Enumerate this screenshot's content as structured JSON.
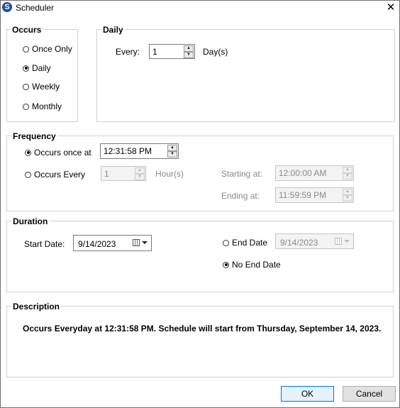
{
  "window": {
    "title": "Scheduler",
    "app_icon_letter": "S",
    "close_glyph": "✕"
  },
  "occurs": {
    "label": "Occurs",
    "options": [
      {
        "label": "Once Only",
        "selected": false
      },
      {
        "label": "Daily",
        "selected": true
      },
      {
        "label": "Weekly",
        "selected": false
      },
      {
        "label": "Monthly",
        "selected": false
      }
    ]
  },
  "daily": {
    "label": "Daily",
    "every_label": "Every:",
    "every_value": "1",
    "unit": "Day(s)"
  },
  "frequency": {
    "label": "Frequency",
    "once_label": "Occurs once at",
    "once_selected": true,
    "once_time": "12:31:58 PM",
    "every_label": "Occurs Every",
    "every_selected": false,
    "every_value": "1",
    "every_unit": "Hour(s)",
    "starting_label": "Starting at:",
    "starting_value": "12:00:00 AM",
    "ending_label": "Ending at:",
    "ending_value": "11:59:59 PM"
  },
  "duration": {
    "label": "Duration",
    "start_label": "Start Date:",
    "start_value": "9/14/2023",
    "end_label": "End Date",
    "end_selected": false,
    "end_value": "9/14/2023",
    "no_end_label": "No End Date",
    "no_end_selected": true
  },
  "description": {
    "label": "Description",
    "text": "Occurs Everyday at 12:31:58 PM. Schedule will start from Thursday, September 14, 2023."
  },
  "buttons": {
    "ok": "OK",
    "cancel": "Cancel"
  },
  "colors": {
    "accent": "#0078d7",
    "border": "#d0d0d0",
    "disabled_text": "#8a8a8a"
  }
}
